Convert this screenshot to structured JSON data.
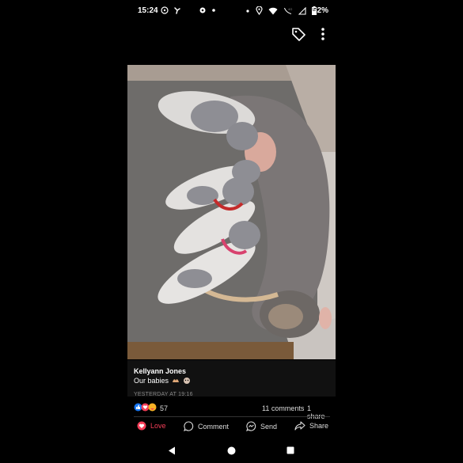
{
  "status_bar": {
    "time": "15:24",
    "battery": "52%",
    "left_icons": [
      "whatsapp-icon",
      "fan-icon",
      "settings-icon",
      "dot-icon"
    ],
    "right_icons": [
      "dot-icon",
      "location-icon",
      "wifi-icon",
      "signal-icon",
      "signal-icon",
      "battery-icon"
    ]
  },
  "top_actions": {
    "tag_icon": "tag-icon",
    "more_icon": "more-vertical-icon"
  },
  "post": {
    "author": "Kellyann Jones",
    "caption": "Our babies",
    "caption_emojis": [
      "hands-icon",
      "dog-face-icon"
    ],
    "timestamp": "YESTERDAY AT 19:16"
  },
  "reactions": {
    "icons": [
      "like-icon",
      "love-icon",
      "care-icon"
    ],
    "count": "57",
    "comments": "11 comments",
    "shares": "1 share"
  },
  "actions": {
    "love": "Love",
    "comment": "Comment",
    "send": "Send",
    "share": "Share"
  },
  "colors": {
    "love": "#f33e58",
    "background": "#000000",
    "like": "#1877f2"
  },
  "nav": [
    "back-icon",
    "home-icon",
    "recents-icon"
  ]
}
